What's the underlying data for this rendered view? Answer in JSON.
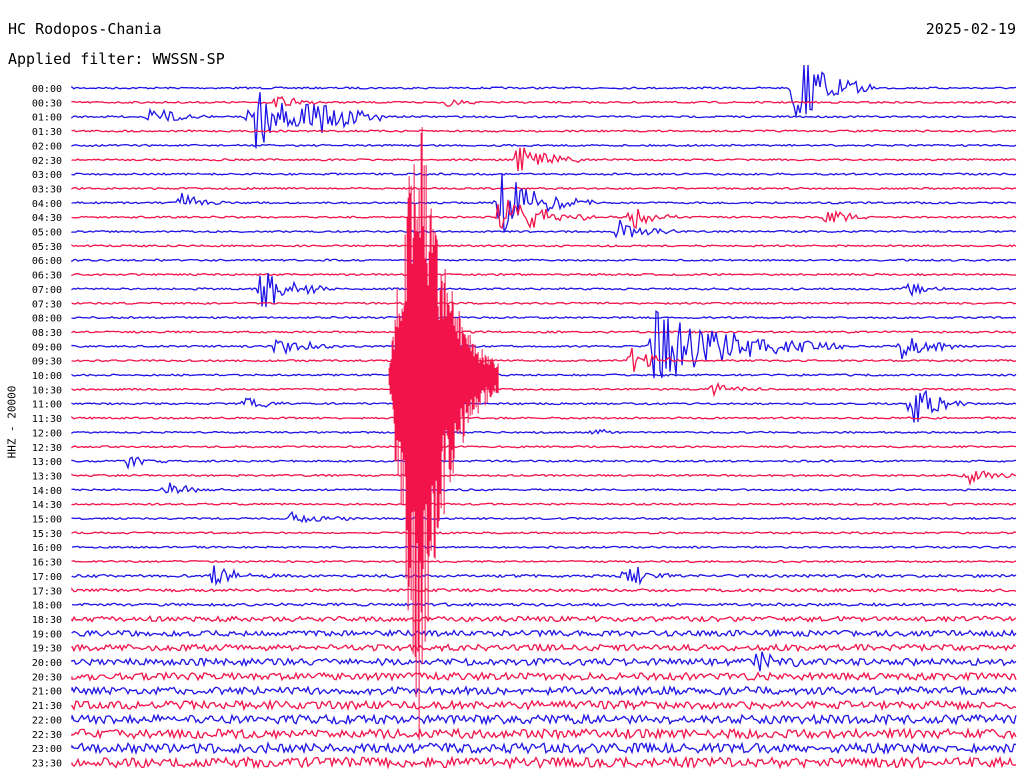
{
  "header": {
    "station": "HC Rodopos-Chania",
    "filter_label": "Applied filter: WWSSN-SP",
    "date": "2025-02-19"
  },
  "channel_label": "HHZ - 20000",
  "colors": {
    "trace_a": "#1f14e6",
    "trace_b": "#f2134a",
    "background": "#ffffff"
  },
  "chart_data": {
    "type": "helicorder",
    "row_labels": [
      "00:00",
      "00:30",
      "01:00",
      "01:30",
      "02:00",
      "02:30",
      "03:00",
      "03:30",
      "04:00",
      "04:30",
      "05:00",
      "05:30",
      "06:00",
      "06:30",
      "07:00",
      "07:30",
      "08:00",
      "08:30",
      "09:00",
      "09:30",
      "10:00",
      "10:30",
      "11:00",
      "11:30",
      "12:00",
      "12:30",
      "13:00",
      "13:30",
      "14:00",
      "14:30",
      "15:00",
      "15:30",
      "16:00",
      "16:30",
      "17:00",
      "17:30",
      "18:00",
      "18:30",
      "19:00",
      "19:30",
      "20:00",
      "20:30",
      "21:00",
      "21:30",
      "22:00",
      "22:30",
      "23:00",
      "23:30"
    ],
    "row_minutes": 30,
    "trace_colors_alternate": [
      "blue",
      "red"
    ],
    "events": [
      {
        "row": 1,
        "minute": 6.5,
        "amp": 0.7,
        "dur": 1.5,
        "color": "blue"
      },
      {
        "row": 1,
        "minute": 12.0,
        "amp": 0.5,
        "dur": 1.0,
        "color": "red"
      },
      {
        "row": 2,
        "minute": 2.5,
        "amp": 0.8,
        "dur": 2.0,
        "color": "blue"
      },
      {
        "row": 2,
        "minute": 5.6,
        "amp": 3.2,
        "dur": 3.0,
        "color": "blue"
      },
      {
        "row": 2,
        "minute": 7.6,
        "amp": 2.2,
        "dur": 2.5,
        "color": "blue"
      },
      {
        "row": 0,
        "minute": 23.0,
        "amp": 3.0,
        "dur": 2.5,
        "color": "blue"
      },
      {
        "row": 5,
        "minute": 14.2,
        "amp": 1.5,
        "dur": 2.0,
        "color": "red"
      },
      {
        "row": 8,
        "minute": 13.6,
        "amp": 2.5,
        "dur": 3.0,
        "color": "blue"
      },
      {
        "row": 8,
        "minute": 3.5,
        "amp": 0.8,
        "dur": 1.5,
        "color": "blue"
      },
      {
        "row": 9,
        "minute": 13.6,
        "amp": 2.0,
        "dur": 3.0,
        "color": "red"
      },
      {
        "row": 9,
        "minute": 17.8,
        "amp": 1.0,
        "dur": 1.5,
        "color": "red"
      },
      {
        "row": 9,
        "minute": 24.0,
        "amp": 0.8,
        "dur": 1.5,
        "color": "red"
      },
      {
        "row": 10,
        "minute": 17.4,
        "amp": 1.0,
        "dur": 2.0,
        "color": "blue"
      },
      {
        "row": 14,
        "minute": 6.0,
        "amp": 1.8,
        "dur": 2.5,
        "color": "blue"
      },
      {
        "row": 14,
        "minute": 26.6,
        "amp": 0.6,
        "dur": 1.5,
        "color": "blue"
      },
      {
        "row": 18,
        "minute": 6.5,
        "amp": 1.0,
        "dur": 2.0,
        "color": "blue"
      },
      {
        "row": 18,
        "minute": 18.5,
        "amp": 3.0,
        "dur": 6.0,
        "color": "red"
      },
      {
        "row": 18,
        "minute": 26.4,
        "amp": 1.2,
        "dur": 2.0,
        "color": "blue"
      },
      {
        "row": 19,
        "minute": 17.8,
        "amp": 1.2,
        "dur": 1.5,
        "color": "red"
      },
      {
        "row": 21,
        "minute": 20.4,
        "amp": 0.7,
        "dur": 1.5,
        "color": "red"
      },
      {
        "row": 22,
        "minute": 5.5,
        "amp": 0.6,
        "dur": 1.5,
        "color": "blue"
      },
      {
        "row": 22,
        "minute": 26.7,
        "amp": 1.8,
        "dur": 2.0,
        "color": "blue"
      },
      {
        "row": 24,
        "minute": 16.5,
        "amp": 0.5,
        "dur": 1.0,
        "color": "blue"
      },
      {
        "row": 26,
        "minute": 1.8,
        "amp": 0.6,
        "dur": 1.5,
        "color": "blue"
      },
      {
        "row": 27,
        "minute": 28.4,
        "amp": 0.7,
        "dur": 2.0,
        "color": "red"
      },
      {
        "row": 28,
        "minute": 3.0,
        "amp": 0.6,
        "dur": 2.0,
        "color": "blue"
      },
      {
        "row": 30,
        "minute": 7.0,
        "amp": 0.7,
        "dur": 2.0,
        "color": "blue"
      },
      {
        "row": 34,
        "minute": 4.5,
        "amp": 0.8,
        "dur": 2.0,
        "color": "blue"
      },
      {
        "row": 34,
        "minute": 17.6,
        "amp": 1.2,
        "dur": 1.5,
        "color": "blue"
      },
      {
        "row": 40,
        "minute": 21.8,
        "amp": 0.8,
        "dur": 1.5,
        "color": "red"
      }
    ],
    "main_event": {
      "row": 20,
      "minute": 11.0,
      "amp": 14.0,
      "dur": 5.0,
      "color": "red"
    }
  }
}
